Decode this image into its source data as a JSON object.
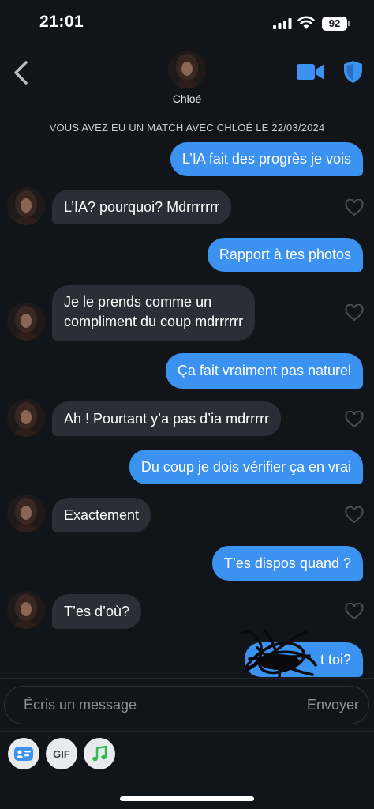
{
  "status_bar": {
    "time": "21:01",
    "battery": "92",
    "icons": [
      "signal-icon",
      "wifi-icon",
      "battery-icon"
    ]
  },
  "header": {
    "contact_name": "Chloé",
    "icons": [
      "back-chevron-icon",
      "video-camera-icon",
      "shield-icon"
    ],
    "accent_color": "#3c92f0"
  },
  "match_banner": "VOUS AVEZ EU UN MATCH AVEC CHLOÉ LE 22/03/2024",
  "messages": [
    {
      "side": "sent",
      "text": "L’IA fait des progrès je vois"
    },
    {
      "side": "received",
      "text": "L’IA? pourquoi? Mdrrrrrrr"
    },
    {
      "side": "sent",
      "text": "Rapport à tes photos"
    },
    {
      "side": "received",
      "lines": [
        "Je le prends comme un",
        "compliment du coup mdrrrrrr"
      ]
    },
    {
      "side": "sent",
      "text": "Ça fait vraiment pas naturel"
    },
    {
      "side": "received",
      "text": "Ah ! Pourtant y’a pas d’ia mdrrrrr"
    },
    {
      "side": "sent",
      "text": "Du coup je dois vérifier ça en vrai"
    },
    {
      "side": "received",
      "text": "Exactement"
    },
    {
      "side": "sent",
      "text": "T’es dispos quand ?"
    },
    {
      "side": "received",
      "text": "T’es d’où?"
    },
    {
      "side": "sent",
      "text": "t toi?",
      "partially_obscured": true
    }
  ],
  "composer": {
    "placeholder": "Écris un message",
    "send_label": "Envoyer"
  },
  "tools": [
    {
      "icon": "id-card-icon"
    },
    {
      "label": "GIF"
    },
    {
      "icon": "music-note-icon",
      "color": "#2dbb4a"
    }
  ],
  "colors": {
    "background": "#111419",
    "sent_bubble": "#3c92f0",
    "received_bubble": "#2a2e36"
  }
}
